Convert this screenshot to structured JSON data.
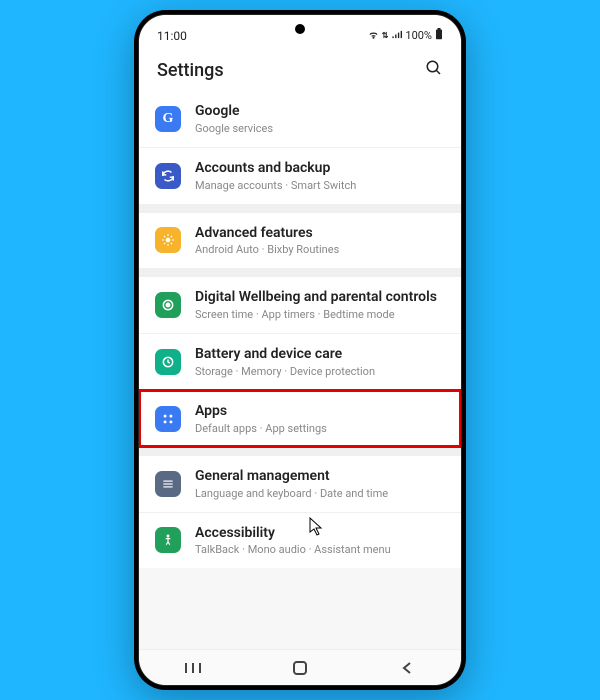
{
  "status": {
    "time": "11:00",
    "battery_text": "100%"
  },
  "header": {
    "title": "Settings"
  },
  "items": [
    {
      "title": "Google",
      "sub": "Google services",
      "icon": "google"
    },
    {
      "title": "Accounts and backup",
      "sub": "Manage accounts · Smart Switch",
      "icon": "sync"
    },
    {
      "title": "Advanced features",
      "sub": "Android Auto · Bixby Routines",
      "icon": "star"
    },
    {
      "title": "Digital Wellbeing and parental controls",
      "sub": "Screen time · App timers · Bedtime mode",
      "icon": "well"
    },
    {
      "title": "Battery and device care",
      "sub": "Storage · Memory · Device protection",
      "icon": "batt"
    },
    {
      "title": "Apps",
      "sub": "Default apps · App settings",
      "icon": "apps",
      "highlighted": true
    },
    {
      "title": "General management",
      "sub": "Language and keyboard · Date and time",
      "icon": "gear"
    },
    {
      "title": "Accessibility",
      "sub": "TalkBack · Mono audio · Assistant menu",
      "icon": "acc"
    }
  ],
  "colors": {
    "highlight": "#e30000",
    "background": "#1fb6ff"
  }
}
